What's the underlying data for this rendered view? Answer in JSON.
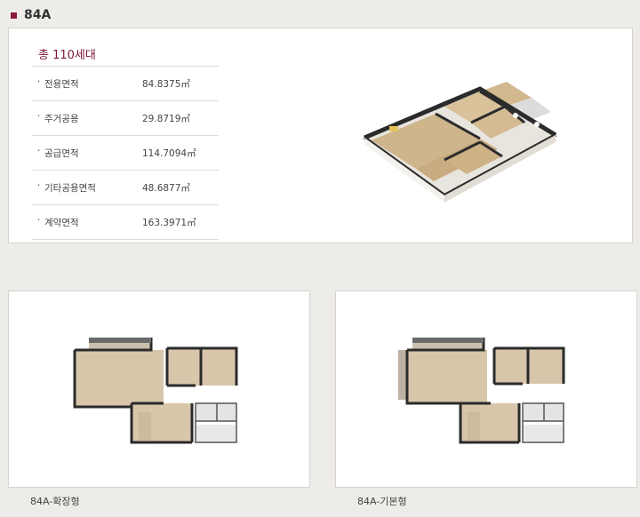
{
  "section": {
    "title": "84A"
  },
  "summary": {
    "total_units": "총 110세대",
    "rows": [
      {
        "label": "전용면적",
        "value": "84.8375㎡"
      },
      {
        "label": "주거공용",
        "value": "29.8719㎡"
      },
      {
        "label": "공급면적",
        "value": "114.7094㎡"
      },
      {
        "label": "기타공용면적",
        "value": "48.6877㎡"
      },
      {
        "label": "계약면적",
        "value": "163.3971㎡"
      }
    ]
  },
  "plans": [
    {
      "caption": "84A-확장형"
    },
    {
      "caption": "84A-기본형"
    }
  ],
  "colors": {
    "accent": "#7a1636",
    "bullet": "#8a1a3c",
    "wall": "#2b2b2b",
    "floor": "#d8c6ab"
  }
}
